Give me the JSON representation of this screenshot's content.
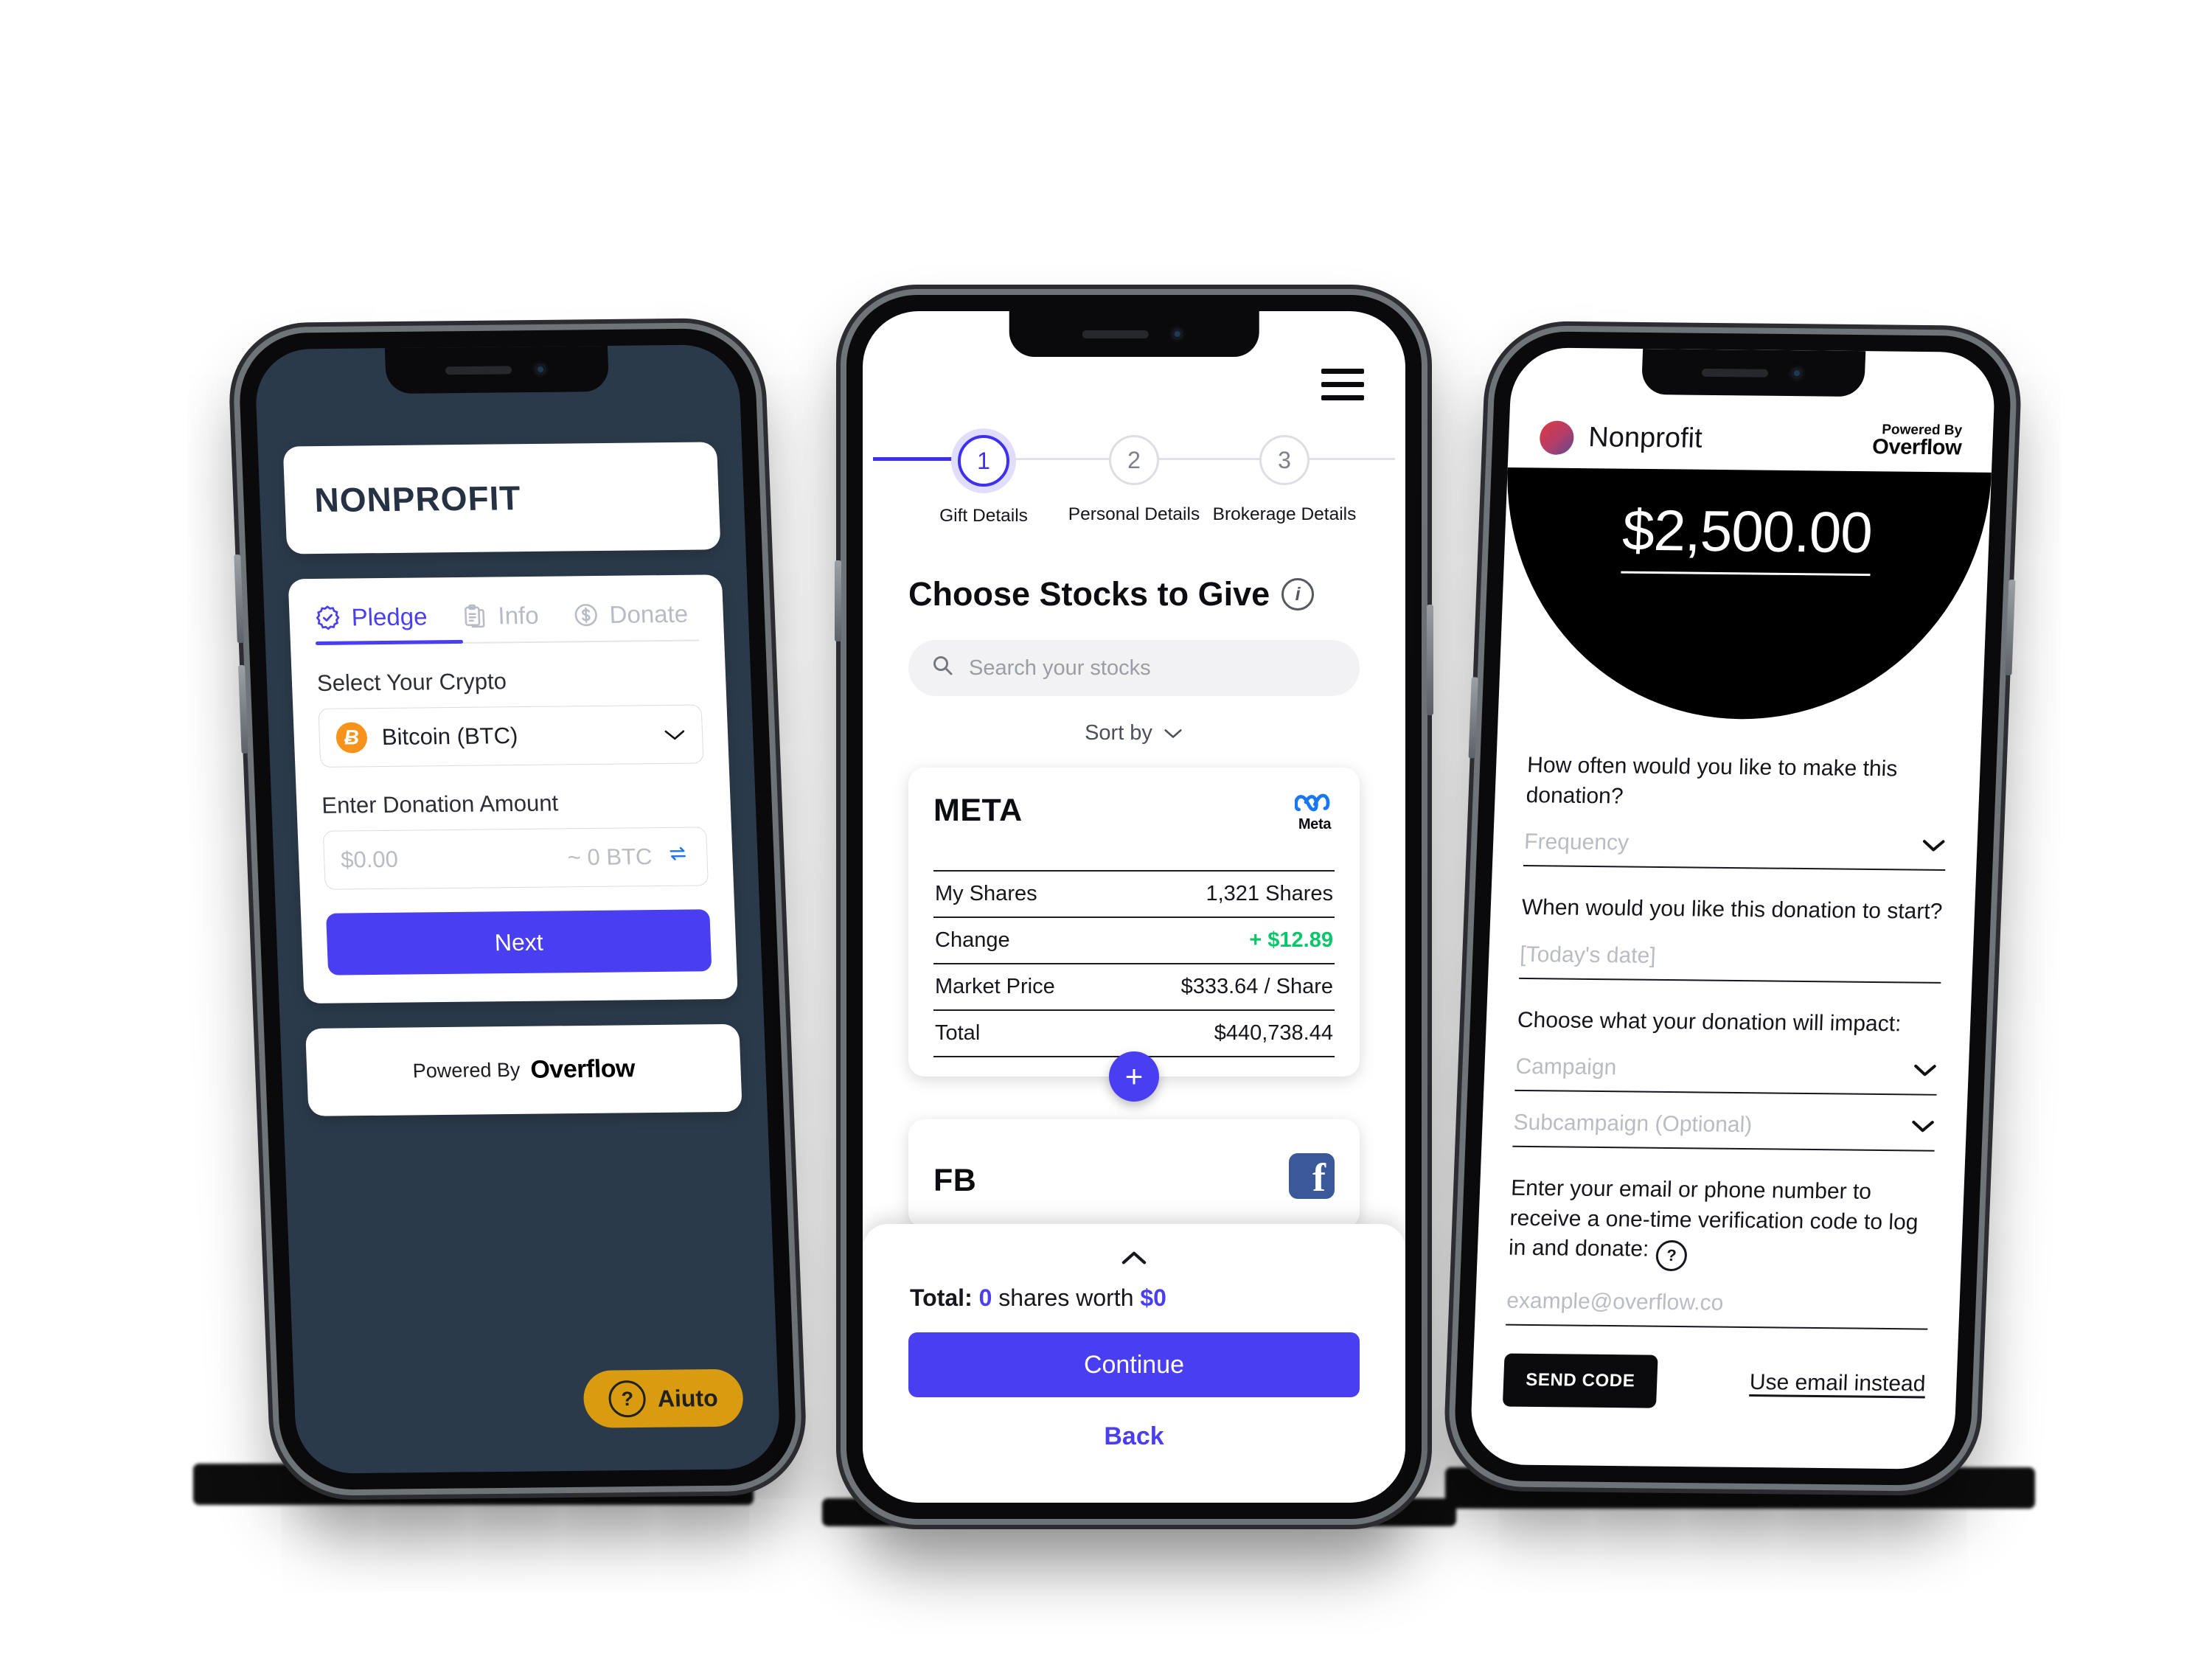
{
  "phone1": {
    "org_title": "NONPROFIT",
    "tabs": [
      {
        "label": "Pledge",
        "icon": "verified-badge-icon",
        "active": true
      },
      {
        "label": "Info",
        "icon": "clipboard-icon",
        "active": false
      },
      {
        "label": "Donate",
        "icon": "dollar-circle-icon",
        "active": false
      }
    ],
    "crypto_label": "Select Your Crypto",
    "crypto_value": "Bitcoin (BTC)",
    "crypto_symbol": "Ƀ",
    "amount_label": "Enter Donation Amount",
    "amount_placeholder": "$0.00",
    "amount_converted": "~ 0 BTC",
    "next_label": "Next",
    "powered_prefix": "Powered By",
    "powered_brand": "Overflow",
    "help_label": "Aiuto",
    "help_icon": "question-mark-icon",
    "accent": "#4A3FF0",
    "background": "#2B3A4A",
    "help_color": "#D99C11"
  },
  "phone2": {
    "menu_icon": "hamburger-menu-icon",
    "steps": [
      {
        "number": "1",
        "label": "Gift Details",
        "active": true
      },
      {
        "number": "2",
        "label": "Personal Details",
        "active": false
      },
      {
        "number": "3",
        "label": "Brokerage Details",
        "active": false
      }
    ],
    "heading": "Choose Stocks to Give",
    "heading_info_icon": "info-circle-icon",
    "search_placeholder": "Search your stocks",
    "search_icon": "search-icon",
    "sort_label": "Sort by",
    "sort_icon": "chevron-down-icon",
    "stock_cards": [
      {
        "ticker": "META",
        "logo": "meta-logo",
        "logo_word": "Meta",
        "rows": [
          {
            "label": "My Shares",
            "value": "1,321 Shares",
            "positive": false
          },
          {
            "label": "Change",
            "value": "+ $12.89",
            "positive": true
          },
          {
            "label": "Market Price",
            "value": "$333.64 / Share",
            "positive": false
          },
          {
            "label": "Total",
            "value": "$440,738.44",
            "positive": false
          }
        ],
        "add_icon": "plus-icon"
      },
      {
        "ticker": "FB",
        "logo": "facebook-logo"
      }
    ],
    "sheet": {
      "collapse_icon": "chevron-up-icon",
      "total_label": "Total:",
      "total_shares": "0",
      "total_shares_suffix": "shares worth",
      "total_value": "$0",
      "continue_label": "Continue",
      "back_label": "Back"
    },
    "accent": "#4A3FF0",
    "positive_color": "#08C66A"
  },
  "phone3": {
    "brand_name": "Nonprofit",
    "brand_avatar": "org-avatar",
    "powered_prefix": "Powered By",
    "powered_brand": "Overflow",
    "amount": "$2,500.00",
    "q_frequency": "How often would you like to make this donation?",
    "frequency_placeholder": "Frequency",
    "q_start": "When would you like this donation to start?",
    "start_placeholder": "[Today's date]",
    "q_impact": "Choose what your donation will impact:",
    "campaign_placeholder": "Campaign",
    "subcampaign_placeholder": "Subcampaign (Optional)",
    "q_verify": "Enter your email or phone number to receive a one-time verification code to log in and donate:",
    "verify_help_icon": "question-circle-icon",
    "email_placeholder": "example@overflow.co",
    "send_code_label": "SEND CODE",
    "use_email_label": "Use email instead",
    "chevron_icon": "chevron-down-icon"
  }
}
